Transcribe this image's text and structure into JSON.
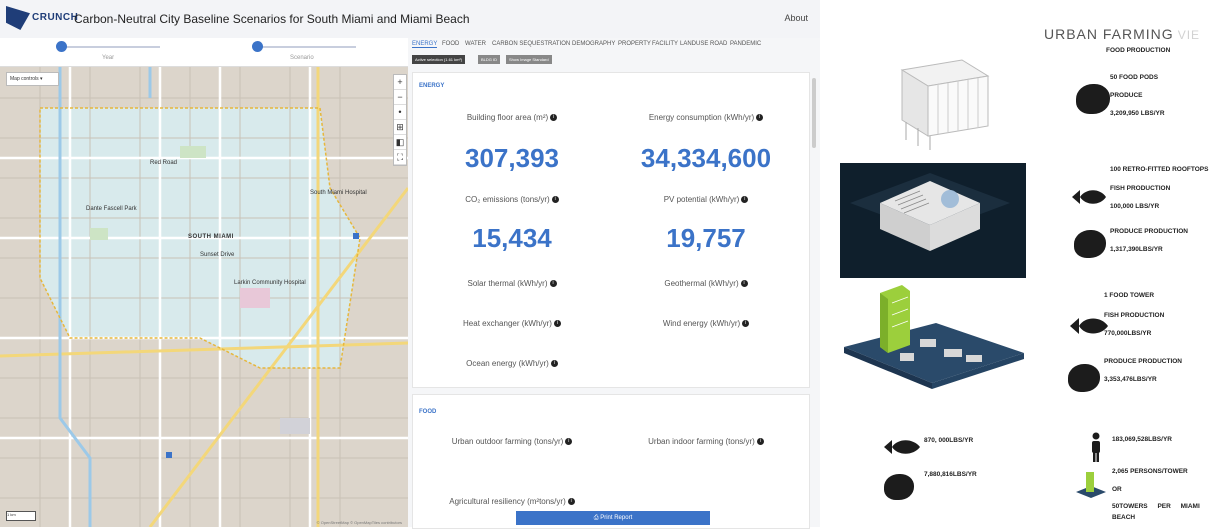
{
  "header": {
    "logo_text": "CRUNCH",
    "title": "Carbon-Neutral City Baseline Scenarios for South Miami and Miami Beach",
    "about": "About"
  },
  "map": {
    "layer_button": "Map controls ▾",
    "slider_left_label": "Year",
    "slider_right_label": "Scenario",
    "city_label": "SOUTH MIAMI",
    "labels": [
      "Sunset Drive",
      "Red Road",
      "South Miami Hospital",
      "Dante Fascell Park",
      "Larkin Community Hospital"
    ],
    "zoom_buttons": [
      "+",
      "−",
      "•",
      "⊞",
      "◧",
      "⛶"
    ],
    "attribution": "© OpenStreetMap © OpenMapTiles contributors",
    "scale": "1 km"
  },
  "panel": {
    "tabs": [
      "ENERGY",
      "FOOD",
      "WATER",
      "CARBON SEQUESTRATION",
      "DEMOGRAPHY",
      "PROPERTY",
      "FACILITY",
      "LANDUSE",
      "ROAD",
      "PANDEMIC"
    ],
    "chips": [
      "Active selection (1.61 km²)",
      "BLDG ID",
      "Show Image Standard"
    ],
    "energy": {
      "title": "ENERGY",
      "building_floor_area_label": "Building floor area (m²)",
      "building_floor_area_value": "307,393",
      "energy_consumption_label": "Energy consumption (kWh/yr)",
      "energy_consumption_value": "34,334,600",
      "co2_label": "CO₂ emissions (tons/yr)",
      "co2_value": "15,434",
      "pv_label": "PV potential (kWh/yr)",
      "pv_value": "19,757",
      "solar_thermal_label": "Solar thermal (kWh/yr)",
      "geothermal_label": "Geothermal (kWh/yr)",
      "heat_exchanger_label": "Heat exchanger (kWh/yr)",
      "wind_label": "Wind energy (kWh/yr)",
      "ocean_label": "Ocean energy (kWh/yr)"
    },
    "food": {
      "title": "FOOD",
      "outdoor_label": "Urban outdoor farming (tons/yr)",
      "indoor_label": "Urban indoor farming (tons/yr)",
      "resiliency_label": "Agricultural resiliency (m²tons/yr)"
    },
    "print_button": "Print Report"
  },
  "farming": {
    "title": "URBAN FARMING",
    "title_faint": "VIE",
    "section1": {
      "heading": "FOOD PRODUCTION",
      "line1": "50 FOOD PODS",
      "line2": "PRODUCE",
      "line3": "3,209,950 LBS/YR"
    },
    "section2": {
      "heading": "100 RETRO-FITTED ROOFTOPS",
      "fish_label": "FISH PRODUCTION",
      "fish_value": "100,000 LBS/YR",
      "produce_label": "PRODUCE PRODUCTION",
      "produce_value": "1,317,390LBS/YR"
    },
    "section3": {
      "heading": "1 FOOD TOWER",
      "fish_label": "FISH PRODUCTION",
      "fish_value": "770,000LBS/YR",
      "produce_label": "PRODUCE PRODUCTION",
      "produce_value": "3,353,476LBS/YR"
    },
    "totals": {
      "fish_total": "870, 000LBS/YR",
      "produce_total": "7,880,816LBS/YR",
      "persons_total": "183,069,528LBS/YR",
      "persons_per_tower": "2,065 PERSONS/TOWER",
      "or": "OR",
      "towers_line1": "50TOWERS PER MIAMI",
      "towers_line2": "BEACH"
    }
  }
}
